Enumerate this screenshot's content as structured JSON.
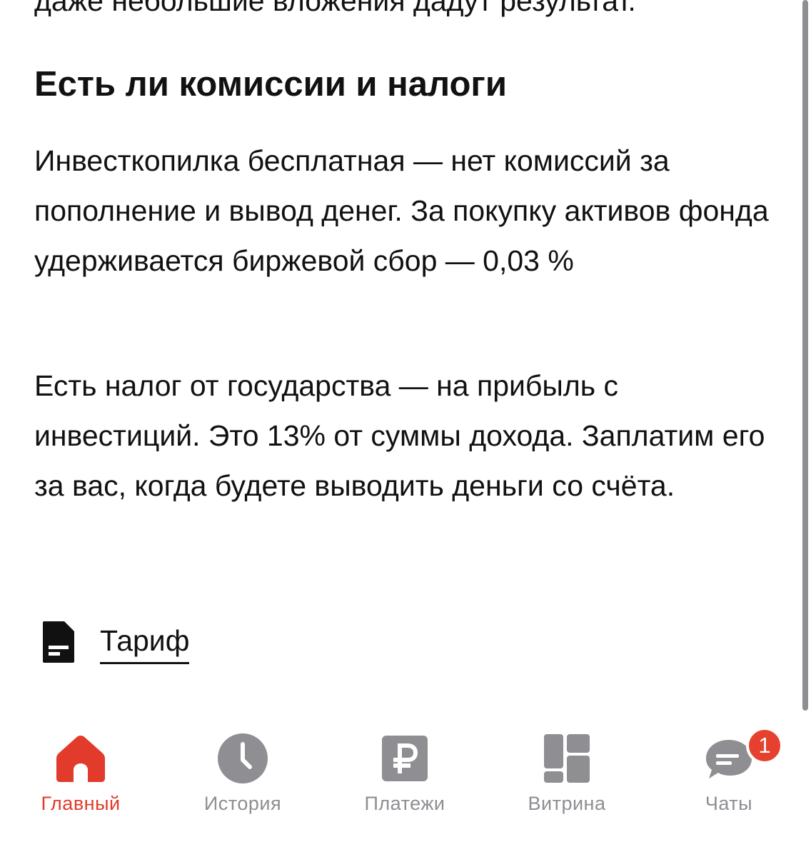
{
  "article": {
    "prev_text": "даже небольшие вложения дадут результат.",
    "section_title": "Есть ли комиссии и налоги",
    "paragraphs": [
      "Инвесткопилка бесплатная — нет комиссий за пополнение и вывод денег. За покупку активов фонда удерживается биржевой сбор — 0,03 %",
      "Есть налог от государства — на прибыль с инвестиций. Это 13% от суммы дохода. Заплатим его за вас, когда будете выводить деньги со счёта."
    ],
    "tariff_link": {
      "label": "Тариф",
      "icon": "document-icon"
    }
  },
  "tabbar": {
    "active_color": "#e23a2b",
    "inactive_color": "#8e8e93",
    "tabs": [
      {
        "label": "Главный",
        "icon": "home-icon",
        "active": true
      },
      {
        "label": "История",
        "icon": "clock-icon",
        "active": false
      },
      {
        "label": "Платежи",
        "icon": "ruble-icon",
        "active": false
      },
      {
        "label": "Витрина",
        "icon": "grid-icon",
        "active": false
      },
      {
        "label": "Чаты",
        "icon": "chat-icon",
        "active": false,
        "badge": "1"
      }
    ]
  }
}
